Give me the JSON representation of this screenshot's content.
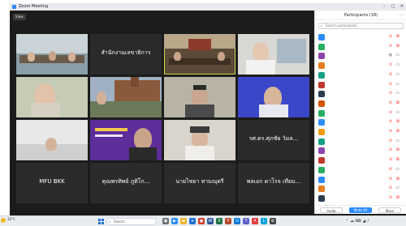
{
  "window": {
    "title": "Zoom Meeting",
    "view_label": "View"
  },
  "tiles": [
    {
      "name": ""
    },
    {
      "name": "",
      "big_label": "สำนักงานเลขาธิการ"
    },
    {
      "name": ""
    },
    {
      "name": ""
    },
    {
      "name": ""
    },
    {
      "name": ""
    },
    {
      "name": ""
    },
    {
      "name": ""
    },
    {
      "name": ""
    },
    {
      "name": ""
    },
    {
      "name": ""
    },
    {
      "name": "",
      "big_label": "รศ.ดร.ศุภชัย วิมล..."
    },
    {
      "name": "",
      "big_label": "MFU BKK"
    },
    {
      "name": "",
      "big_label": "คุณพรทิพย์ ภูติโก..."
    },
    {
      "name": "",
      "big_label": "นายไชยา ทามณุตรี"
    },
    {
      "name": "",
      "big_label": "พลเอก ดาโรจ เทียบ..."
    }
  ],
  "participants_panel": {
    "title": "Participants (18)",
    "search_placeholder": "Search participants",
    "footer_invite": "Invite",
    "footer_mute": "Mute All",
    "footer_more": "More",
    "list": [
      {
        "initial": "",
        "color": "#2d8cff",
        "mic": "muted",
        "video": "off"
      },
      {
        "initial": "",
        "color": "#27ae60",
        "mic": "muted",
        "video": "off"
      },
      {
        "initial": "",
        "color": "#8e44ad",
        "mic": "on",
        "video": "on"
      },
      {
        "initial": "",
        "color": "#e67e22",
        "mic": "muted",
        "video": "on"
      },
      {
        "initial": "",
        "color": "#16a085",
        "mic": "muted",
        "video": "on"
      },
      {
        "initial": "",
        "color": "#c0392b",
        "mic": "muted",
        "video": "on"
      },
      {
        "initial": "",
        "color": "#2c3e50",
        "mic": "muted",
        "video": "on"
      },
      {
        "initial": "",
        "color": "#d35400",
        "mic": "muted",
        "video": "off"
      },
      {
        "initial": "",
        "color": "#27ae60",
        "mic": "muted",
        "video": "on"
      },
      {
        "initial": "",
        "color": "#2d8cff",
        "mic": "muted",
        "video": "off"
      },
      {
        "initial": "",
        "color": "#f39c12",
        "mic": "muted",
        "video": "off"
      },
      {
        "initial": "",
        "color": "#16a085",
        "mic": "muted",
        "video": "on"
      },
      {
        "initial": "",
        "color": "#8e44ad",
        "mic": "muted",
        "video": "off"
      },
      {
        "initial": "",
        "color": "#c0392b",
        "mic": "muted",
        "video": "off"
      },
      {
        "initial": "",
        "color": "#27ae60",
        "mic": "muted",
        "video": "on"
      },
      {
        "initial": "",
        "color": "#2d8cff",
        "mic": "muted",
        "video": "off"
      },
      {
        "initial": "",
        "color": "#e67e22",
        "mic": "muted",
        "video": "on"
      },
      {
        "initial": "",
        "color": "#2c3e50",
        "mic": "muted",
        "video": "off"
      }
    ]
  },
  "taskbar": {
    "weather_temp": "32°C",
    "weather_desc": "",
    "search_placeholder": "Search",
    "time": "",
    "date": ""
  },
  "colors": {
    "accent": "#2d8cff",
    "muted": "#ff4a4a",
    "panel_bg": "#ffffff",
    "meeting_bg": "#1c1c1c"
  }
}
